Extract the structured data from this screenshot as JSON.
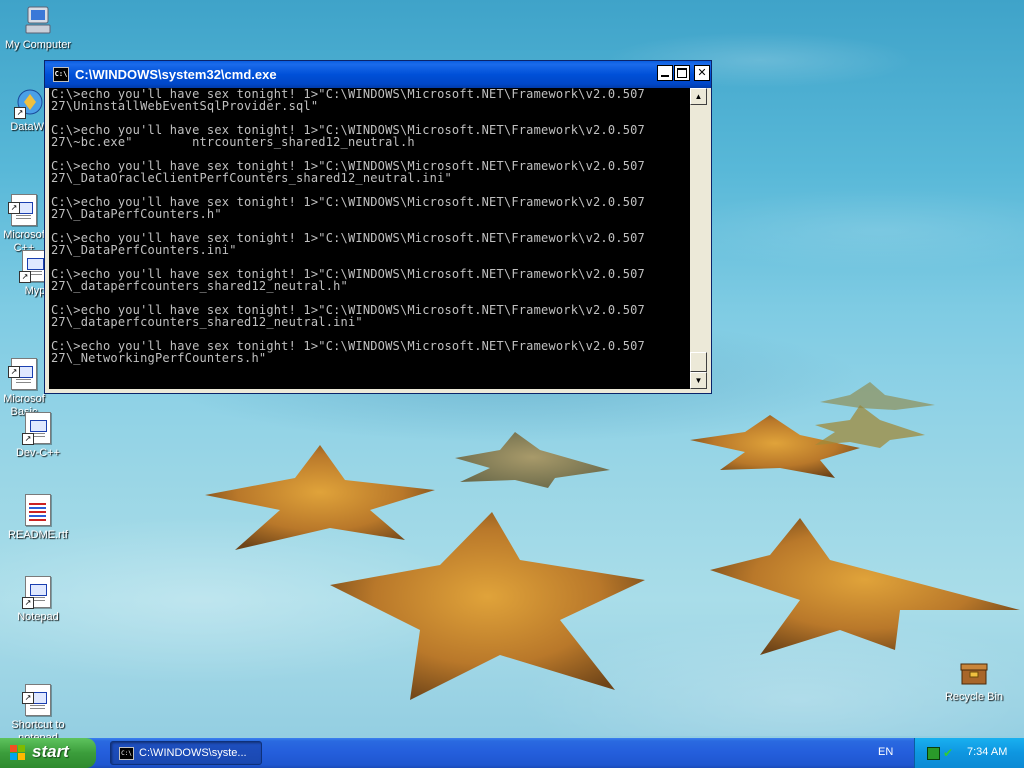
{
  "desktop": {
    "icons": [
      {
        "name": "my-computer-icon",
        "label": "My Computer"
      },
      {
        "name": "datawatch-icon",
        "label": "DataWa"
      },
      {
        "name": "visual-cpp-icon",
        "label": "Microsof\nC++"
      },
      {
        "name": "myp-icon",
        "label": "Myp"
      },
      {
        "name": "visual-basic-icon",
        "label": "Microsof\nBasic"
      },
      {
        "name": "devcpp-icon",
        "label": "Dev-C++"
      },
      {
        "name": "readme-icon",
        "label": "README.rtf"
      },
      {
        "name": "notepad-icon",
        "label": "Notepad"
      },
      {
        "name": "shortcut-notepad-icon",
        "label": "Shortcut to\nnotepad"
      },
      {
        "name": "recycle-bin-icon",
        "label": "Recycle Bin"
      }
    ]
  },
  "window": {
    "title": "C:\\WINDOWS\\system32\\cmd.exe",
    "icon_text": "C:\\",
    "console_lines": [
      "C:\\>echo you'll have sex tonight! 1>\"C:\\WINDOWS\\Microsoft.NET\\Framework\\v2.0.507",
      "27\\UninstallWebEventSqlProvider.sql\"",
      "",
      "C:\\>echo you'll have sex tonight! 1>\"C:\\WINDOWS\\Microsoft.NET\\Framework\\v2.0.507",
      "27\\~bc.exe\"        ntrcounters_shared12_neutral.h",
      "",
      "C:\\>echo you'll have sex tonight! 1>\"C:\\WINDOWS\\Microsoft.NET\\Framework\\v2.0.507",
      "27\\_DataOracleClientPerfCounters_shared12_neutral.ini\"",
      "",
      "C:\\>echo you'll have sex tonight! 1>\"C:\\WINDOWS\\Microsoft.NET\\Framework\\v2.0.507",
      "27\\_DataPerfCounters.h\"",
      "",
      "C:\\>echo you'll have sex tonight! 1>\"C:\\WINDOWS\\Microsoft.NET\\Framework\\v2.0.507",
      "27\\_DataPerfCounters.ini\"",
      "",
      "C:\\>echo you'll have sex tonight! 1>\"C:\\WINDOWS\\Microsoft.NET\\Framework\\v2.0.507",
      "27\\_dataperfcounters_shared12_neutral.h\"",
      "",
      "C:\\>echo you'll have sex tonight! 1>\"C:\\WINDOWS\\Microsoft.NET\\Framework\\v2.0.507",
      "27\\_dataperfcounters_shared12_neutral.ini\"",
      "",
      "C:\\>echo you'll have sex tonight! 1>\"C:\\WINDOWS\\Microsoft.NET\\Framework\\v2.0.507",
      "27\\_NetworkingPerfCounters.h\""
    ]
  },
  "taskbar": {
    "start_label": "start",
    "task_label": "C:\\WINDOWS\\syste...",
    "language": "EN",
    "clock": "7:34 AM"
  },
  "colors": {
    "titlebar": "#0050d8",
    "console_bg": "#000000",
    "console_fg": "#c0c0c0",
    "taskbar": "#245edc",
    "start_button": "#3b9d3b",
    "tray": "#0e96e0"
  }
}
